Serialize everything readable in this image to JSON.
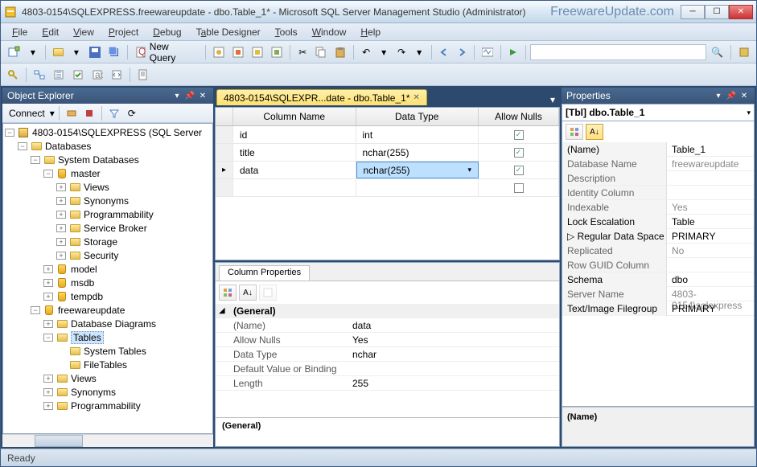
{
  "window": {
    "title": "4803-0154\\SQLEXPRESS.freewareupdate - dbo.Table_1* - Microsoft SQL Server Management Studio (Administrator)",
    "brand": "FreewareUpdate.com"
  },
  "menu": [
    "File",
    "Edit",
    "View",
    "Project",
    "Debug",
    "Table Designer",
    "Tools",
    "Window",
    "Help"
  ],
  "toolbar": {
    "new_query": "New Query"
  },
  "object_explorer": {
    "title": "Object Explorer",
    "connect_label": "Connect",
    "server": "4803-0154\\SQLEXPRESS (SQL Server",
    "nodes": {
      "databases": "Databases",
      "system_databases": "System Databases",
      "master": "master",
      "views": "Views",
      "synonyms": "Synonyms",
      "programmability": "Programmability",
      "service_broker": "Service Broker",
      "storage": "Storage",
      "security": "Security",
      "model": "model",
      "msdb": "msdb",
      "tempdb": "tempdb",
      "freewareupdate": "freewareupdate",
      "database_diagrams": "Database Diagrams",
      "tables": "Tables",
      "system_tables": "System Tables",
      "filetables": "FileTables",
      "views2": "Views",
      "synonyms2": "Synonyms",
      "programmability2": "Programmability"
    }
  },
  "document_tab": {
    "title": "4803-0154\\SQLEXPR...date - dbo.Table_1*"
  },
  "designer": {
    "headers": {
      "col": "Column Name",
      "type": "Data Type",
      "nulls": "Allow Nulls"
    },
    "rows": [
      {
        "name": "id",
        "type": "int",
        "nulls": true
      },
      {
        "name": "title",
        "type": "nchar(255)",
        "nulls": true
      },
      {
        "name": "data",
        "type": "nchar(255)",
        "nulls": true
      }
    ]
  },
  "column_properties": {
    "title": "Column Properties",
    "category": "(General)",
    "rows": [
      {
        "name": "(Name)",
        "value": "data"
      },
      {
        "name": "Allow Nulls",
        "value": "Yes"
      },
      {
        "name": "Data Type",
        "value": "nchar"
      },
      {
        "name": "Default Value or Binding",
        "value": ""
      },
      {
        "name": "Length",
        "value": "255"
      }
    ],
    "desc_label": "(General)"
  },
  "properties": {
    "title": "Properties",
    "object": "[Tbl] dbo.Table_1",
    "rows": [
      {
        "name": "(Name)",
        "value": "Table_1",
        "bold": true
      },
      {
        "name": "Database Name",
        "value": "freewareupdate"
      },
      {
        "name": "Description",
        "value": ""
      },
      {
        "name": "Identity Column",
        "value": ""
      },
      {
        "name": "Indexable",
        "value": "Yes"
      },
      {
        "name": "Lock Escalation",
        "value": "Table",
        "bold": true
      },
      {
        "name": "Regular Data Space",
        "value": "PRIMARY",
        "bold": true,
        "expand": true
      },
      {
        "name": "Replicated",
        "value": "No"
      },
      {
        "name": "Row GUID Column",
        "value": ""
      },
      {
        "name": "Schema",
        "value": "dbo",
        "bold": true
      },
      {
        "name": "Server Name",
        "value": "4803-0154\\sqlexpress"
      },
      {
        "name": "Text/Image Filegroup",
        "value": "PRIMARY",
        "bold": true
      }
    ],
    "footer": "(Name)"
  },
  "status": "Ready"
}
